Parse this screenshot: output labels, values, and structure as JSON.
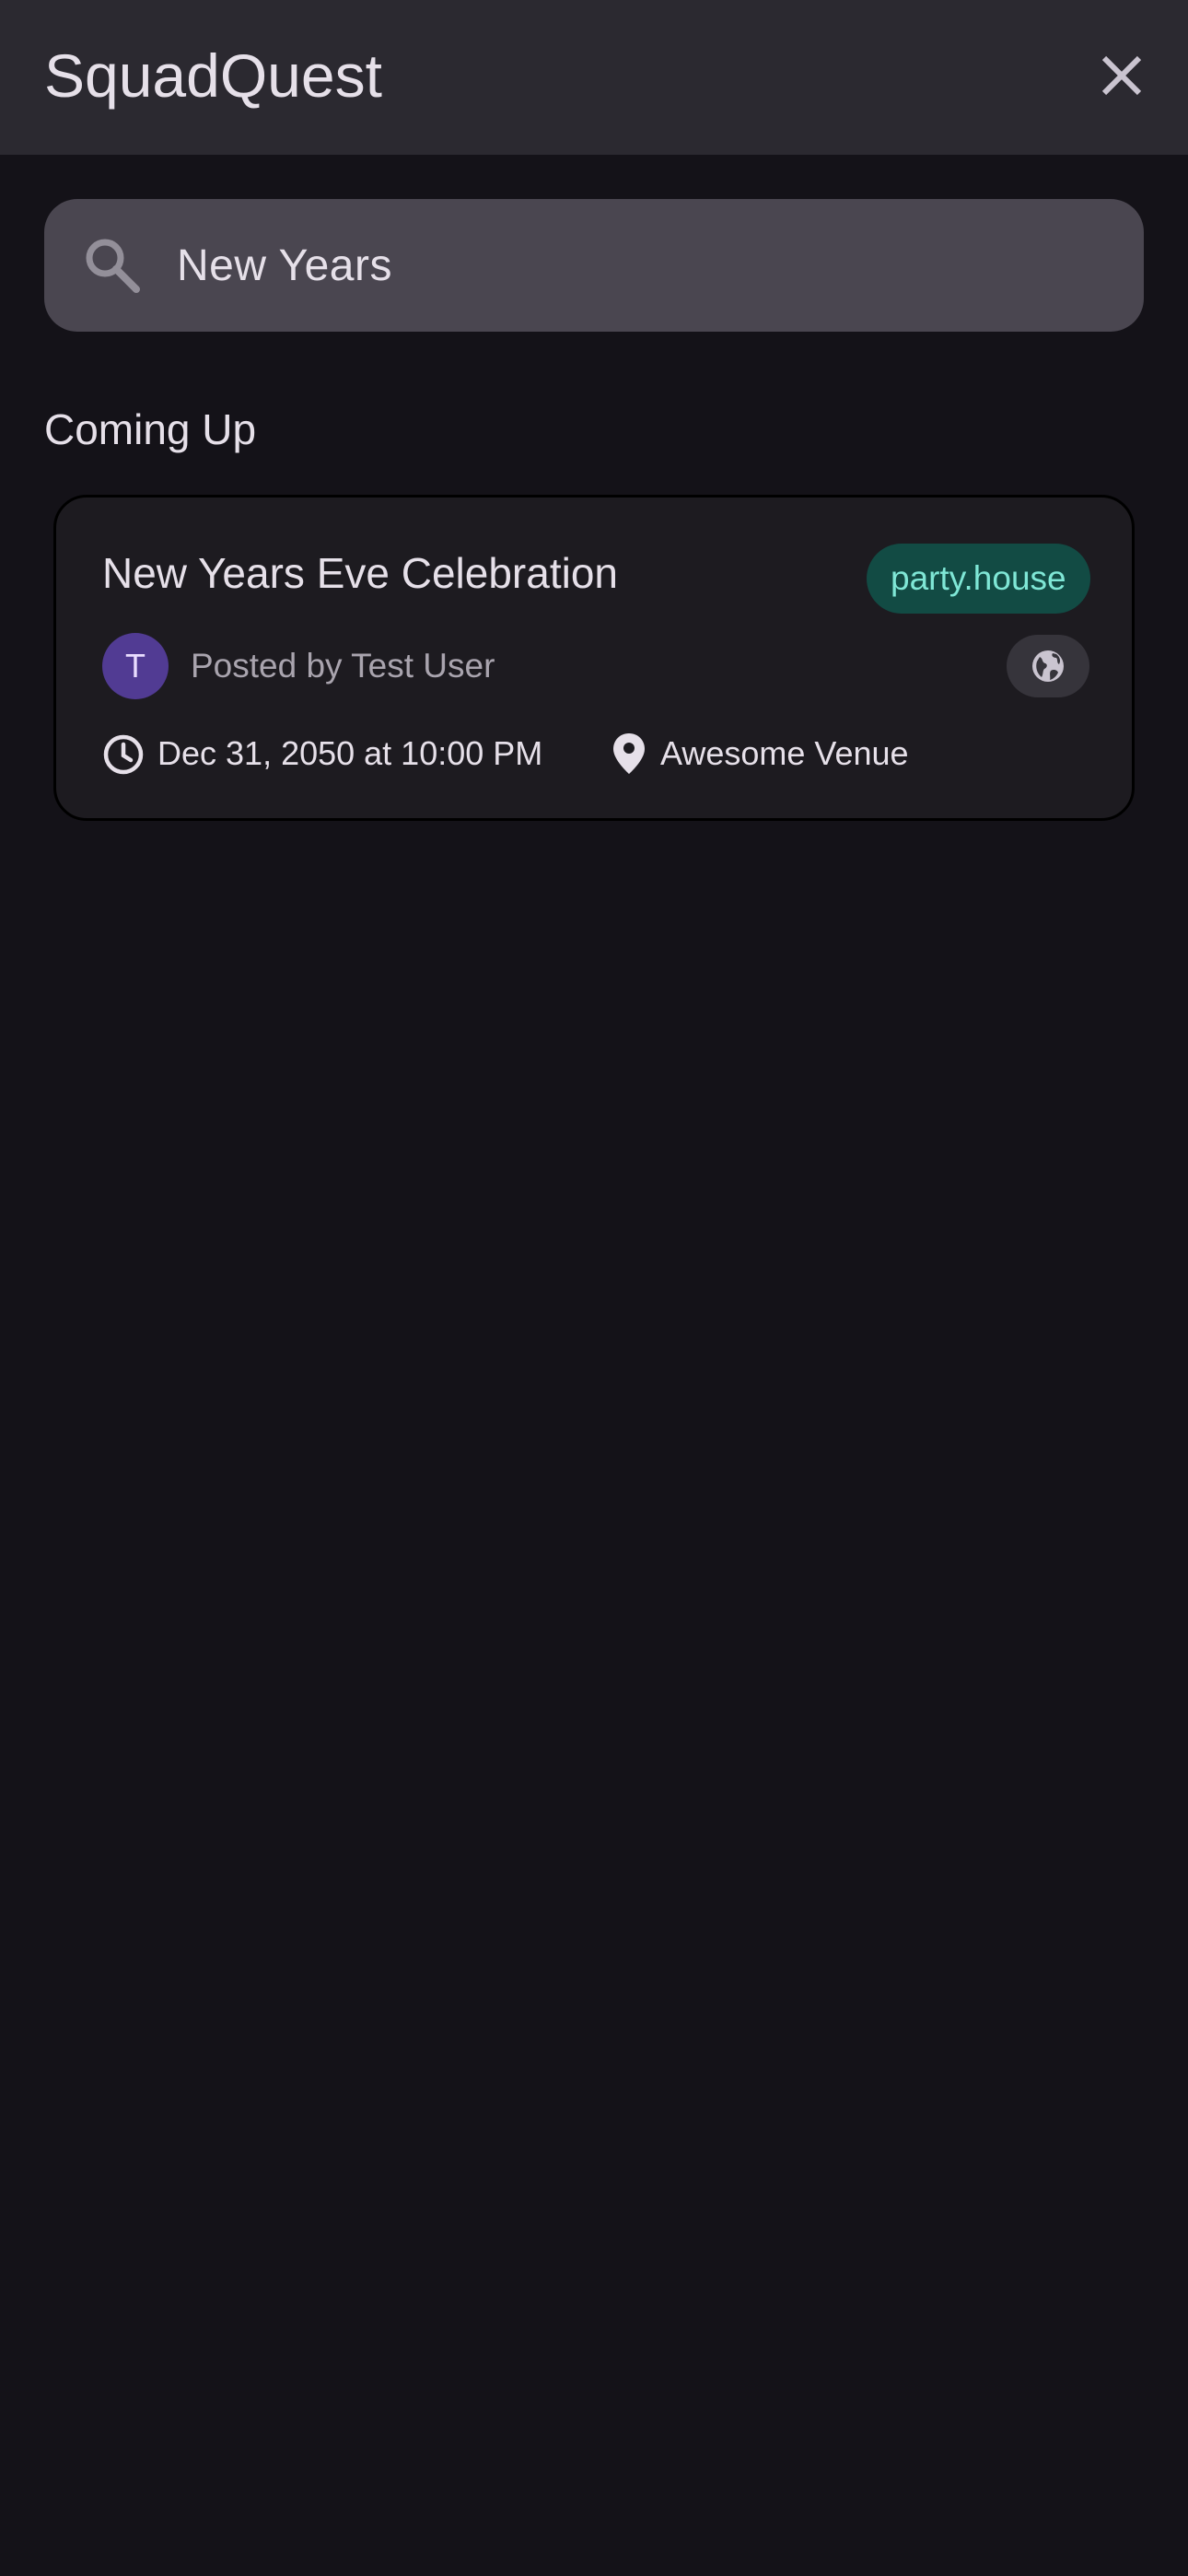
{
  "app_bar": {
    "title": "SquadQuest",
    "close_icon": "close-icon"
  },
  "search": {
    "value": "New Years",
    "icon": "search-icon"
  },
  "section": {
    "title": "Coming Up"
  },
  "events": [
    {
      "title": "New Years Eve Celebration",
      "topic": "party.house",
      "avatar_initial": "T",
      "posted_by": "Posted by Test User",
      "visibility_icon": "globe-icon",
      "datetime": "Dec 31, 2050 at 10:00 PM",
      "location": "Awesome Venue"
    }
  ],
  "colors": {
    "background": "#141218",
    "app_bar": "#2b2930",
    "search_field": "#4a4650",
    "card": "#1d1b20",
    "topic_chip_bg": "#124b44",
    "topic_chip_text": "#7fe7d6",
    "avatar_bg": "#513b93"
  }
}
